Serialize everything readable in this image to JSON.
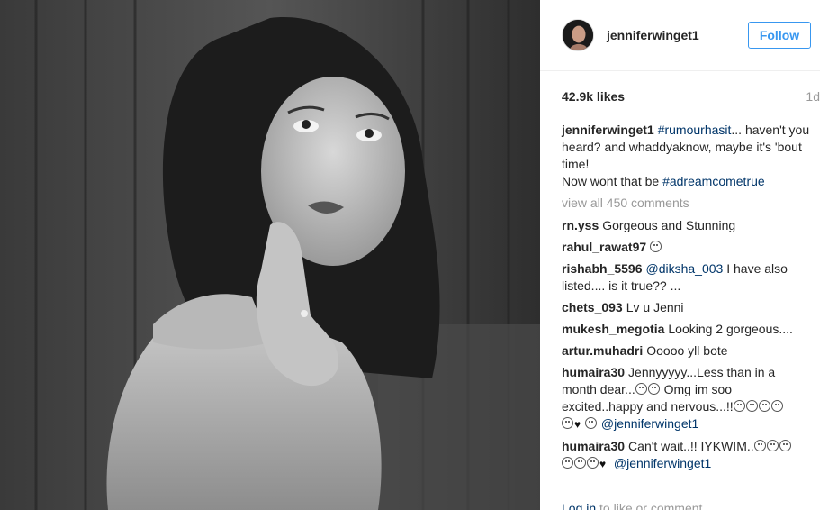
{
  "header": {
    "username": "jenniferwinget1",
    "follow_label": "Follow"
  },
  "meta": {
    "likes": "42.9k likes",
    "age": "1d"
  },
  "caption": {
    "user": "jenniferwinget1",
    "tag1": "#rumourhasit",
    "text1": "... haven't you heard? and whaddyaknow, maybe it's 'bout time!",
    "text2": "Now wont that be ",
    "tag2": "#adreamcometrue"
  },
  "view_all": "view all 450 comments",
  "comments": [
    {
      "user": "rn.yss",
      "text": "Gorgeous and Stunning"
    },
    {
      "user": "rahul_rawat97",
      "text": ""
    },
    {
      "user": "rishabh_5596",
      "mention": "@diksha_003",
      "text": " I have also listed.... is it true?? ..."
    },
    {
      "user": "chets_093",
      "text": "Lv u Jenni"
    },
    {
      "user": "mukesh_megotia",
      "text": "Looking 2 gorgeous...."
    },
    {
      "user": "artur.muhadri",
      "text": "Ooooo yll bote"
    },
    {
      "user": "humaira30",
      "text": "Jennyyyyy...Less than in a month dear...",
      "text_b": " Omg im soo excited..happy and nervous...!!",
      "mention": "@jenniferwinget1"
    },
    {
      "user": "humaira30",
      "text": "Can't wait..!! IYKWIM..",
      "mention": "@jenniferwinget1"
    }
  ],
  "footer": {
    "login": "Log in",
    "rest": " to like or comment."
  }
}
